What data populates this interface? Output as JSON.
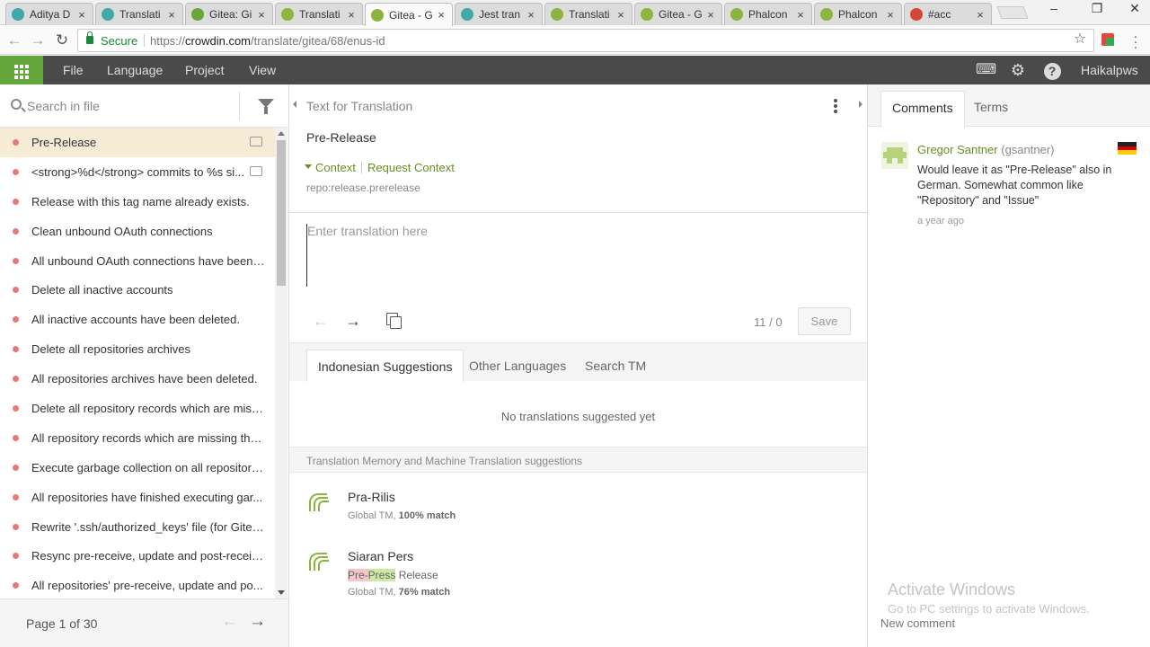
{
  "browser": {
    "tabs": [
      {
        "title": "Aditya D",
        "fav": "#3fa9a9"
      },
      {
        "title": "Translati",
        "fav": "#3fa9a9"
      },
      {
        "title": "Gitea: Gi",
        "fav": "#6ba33c"
      },
      {
        "title": "Translati",
        "fav": "#8cb33d"
      },
      {
        "title": "Gitea - G",
        "fav": "#8cb33d"
      },
      {
        "title": "Jest tran",
        "fav": "#3fa9a9"
      },
      {
        "title": "Translati",
        "fav": "#8cb33d"
      },
      {
        "title": "Gitea - G",
        "fav": "#8cb33d"
      },
      {
        "title": "Phalcon",
        "fav": "#8cb33d"
      },
      {
        "title": "Phalcon",
        "fav": "#8cb33d"
      },
      {
        "title": "#acc",
        "fav": "#d6453c"
      }
    ],
    "active_tab": 4,
    "secure_label": "Secure",
    "url_prefix": "https://",
    "url_host": "crowdin.com",
    "url_path": "/translate/gitea/68/enus-id"
  },
  "app_menu": {
    "items": [
      "File",
      "Language",
      "Project",
      "View"
    ],
    "user": "Haikalpws"
  },
  "left": {
    "search_placeholder": "Search in file",
    "strings": [
      "Pre-Release",
      "<strong>%d</strong> commits to %s si...",
      "Release with this tag name already exists.",
      "Clean unbound OAuth connections",
      "All unbound OAuth connections have been ...",
      "Delete all inactive accounts",
      "All inactive accounts have been deleted.",
      "Delete all repositories archives",
      "All repositories archives have been deleted.",
      "Delete all repository records which are miss...",
      "All repository records which are missing the...",
      "Execute garbage collection on all repositories",
      "All repositories have finished executing gar...",
      "Rewrite '.ssh/authorized_keys' file (for Gitea...",
      "Resync pre-receive, update and post-receiv...",
      "All repositories' pre-receive, update and po..."
    ],
    "page_info": "Page 1 of 30"
  },
  "center": {
    "header": "Text for Translation",
    "source_text": "Pre-Release",
    "context_label": "Context",
    "request_context_label": "Request Context",
    "string_key": "repo:release.prerelease",
    "input_placeholder": "Enter translation here",
    "counter": "11 / 0",
    "save_label": "Save",
    "tabs": [
      "Indonesian Suggestions",
      "Other Languages",
      "Search TM"
    ],
    "no_suggestions": "No translations suggested yet",
    "tm_header": "Translation Memory and Machine Translation suggestions",
    "suggestions": [
      {
        "text": "Pra-Rilis",
        "source_label": "Global TM, ",
        "match": "100% match"
      },
      {
        "text": "Siaran Pers",
        "src_del": "Pre-",
        "src_add": "Press",
        "src_rest": " Release",
        "source_label": "Global TM, ",
        "match": "76% match"
      }
    ]
  },
  "right": {
    "tabs": [
      "Comments",
      "Terms"
    ],
    "comment": {
      "author": "Gregor Santner",
      "handle": "(gsantner)",
      "text": "Would leave it as \"Pre-Release\" also in German. Somewhat common like \"Repository\" and \"Issue\"",
      "time": "a year ago"
    },
    "watermark_title": "Activate Windows",
    "watermark_sub": "Go to PC settings to activate Windows.",
    "new_comment": "New comment"
  }
}
